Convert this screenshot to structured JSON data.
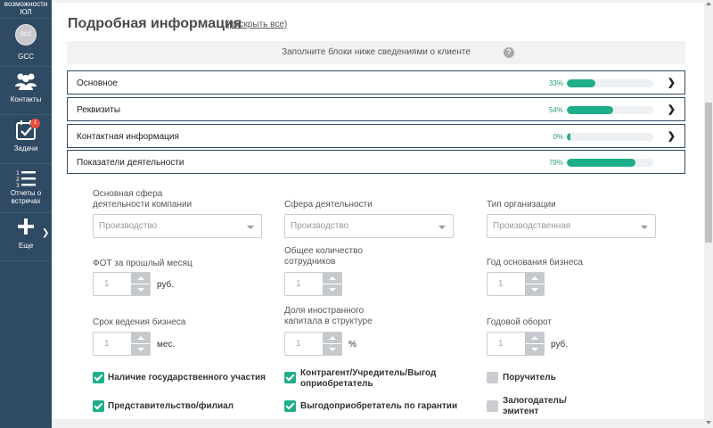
{
  "sidebar": {
    "top_label_line1": "возможности",
    "top_label_line2": "ЮЛ",
    "gcc": {
      "avatar_text": "GCC",
      "label": "GCC"
    },
    "contacts_label": "Контакты",
    "tasks_label": "Задачи",
    "tasks_badge": "1",
    "reports_line1": "Отчеты о",
    "reports_line2": "встречах",
    "more_label": "Еще"
  },
  "section": {
    "title": "Подробная информация",
    "expand_link": "(раскрыть все)"
  },
  "hint": {
    "text": "Заполните блоки ниже сведениями о клиенте",
    "icon": "?"
  },
  "blocks": [
    {
      "label": "Основное",
      "percent_text": "33%",
      "progress": 0.33
    },
    {
      "label": "Реквизиты",
      "percent_text": "54%",
      "progress": 0.54
    },
    {
      "label": "Контактная информация",
      "percent_text": "0%",
      "progress": 0.0
    },
    {
      "label": "Показатели деятельности",
      "percent_text": "79%",
      "progress": 0.79
    }
  ],
  "form": {
    "main_sphere": {
      "label_line1": "Основная сфера",
      "label_line2": "деятельности компании",
      "value": "Производство"
    },
    "sphere": {
      "label": "Сфера деятельности",
      "value": "Производство"
    },
    "org_type": {
      "label": "Тип организации",
      "value": "Производственная"
    },
    "fot": {
      "label": "ФОТ за прошлый месяц",
      "value": "1",
      "unit": "руб."
    },
    "employees": {
      "label_line1": "Общее количество",
      "label_line2": "сотрудников",
      "value": "1"
    },
    "founded": {
      "label": "Год основания бизнеса",
      "value": "1"
    },
    "duration": {
      "label": "Срок ведения бизнеса",
      "value": "1",
      "unit": "мес."
    },
    "foreign_capital": {
      "label_line1": "Доля иностранного",
      "label_line2": "капитала в структуре",
      "value": "1",
      "unit": "%"
    },
    "turnover": {
      "label": "Годовой оборот",
      "value": "1",
      "unit": "руб."
    },
    "checkboxes": {
      "state": {
        "label": "Наличие государственного участия",
        "checked": true
      },
      "counterparty_line1": "Контрагент/Учредитель/Выгод",
      "counterparty_line2": "оприобретатель",
      "counterparty_checked": true,
      "guarantor": {
        "label": "Поручитель",
        "checked": false
      },
      "branch": {
        "label": "Представительство/филиал",
        "checked": true
      },
      "beneficiary": {
        "label": "Выгодоприобретатель по гарантии",
        "checked": true
      },
      "pledgor_line1": "Залогодатель/",
      "pledgor_line2": "эмитент",
      "pledgor_checked": false
    }
  },
  "colors": {
    "sidebar_bg": "#2f4a63",
    "accent": "#1fae8a",
    "badge": "#e74c3c"
  }
}
